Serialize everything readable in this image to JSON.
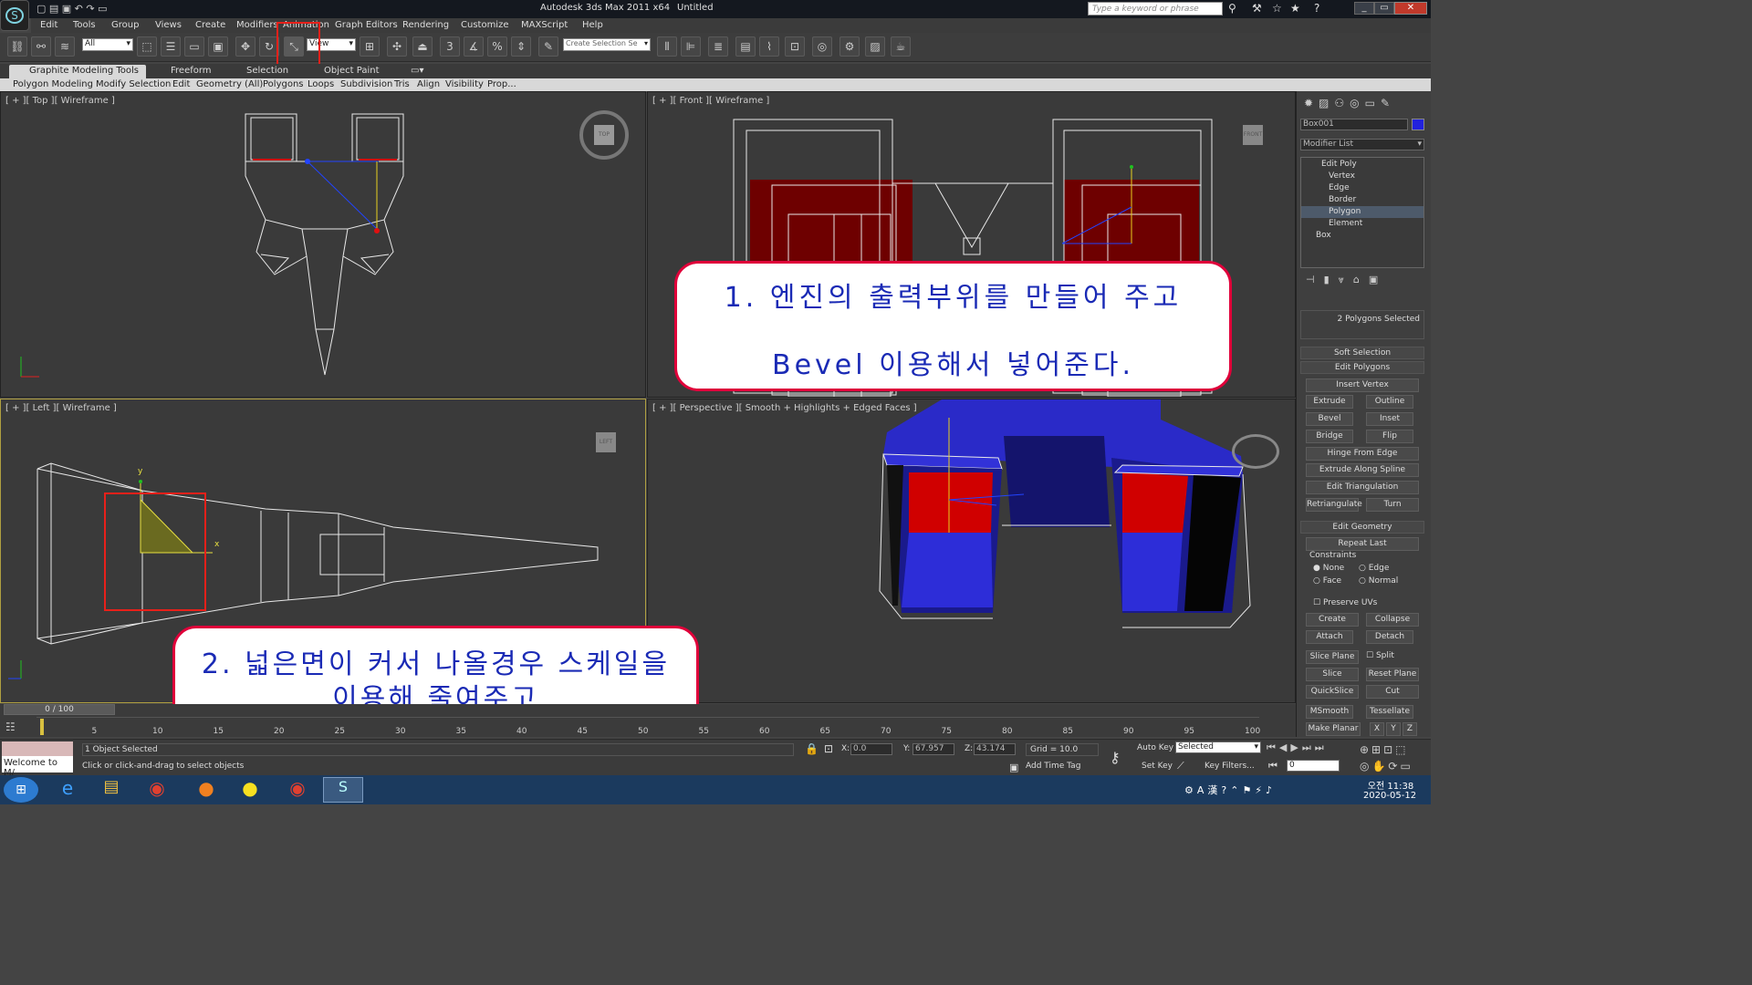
{
  "title": {
    "app": "Autodesk 3ds Max  2011 x64",
    "doc": "Untitled",
    "search_placeholder": "Type a keyword or phrase"
  },
  "menu": [
    "Edit",
    "Tools",
    "Group",
    "Views",
    "Create",
    "Modifiers",
    "Animation",
    "Graph Editors",
    "Rendering",
    "Customize",
    "MAXScript",
    "Help"
  ],
  "toolbar": {
    "selection_filter": "All",
    "ref_coord": "View",
    "named_selection": "Create Selection Se"
  },
  "ribbon": {
    "tabs": [
      "Graphite Modeling Tools",
      "Freeform",
      "Selection",
      "Object Paint"
    ],
    "subtabs": [
      "Polygon Modeling",
      "Modify Selection",
      "Edit",
      "Geometry (All)",
      "Polygons",
      "Loops",
      "Subdivision",
      "Tris",
      "Align",
      "Visibility",
      "Prop..."
    ]
  },
  "viewports": {
    "top": "[ + ][ Top ][ Wireframe ]",
    "front": "[ + ][ Front ][ Wireframe ]",
    "left": "[ + ][ Left ][ Wireframe ]",
    "persp": "[ + ][ Perspective ][ Smooth + Highlights + Edged Faces ]",
    "cube_top": "TOP",
    "cube_front": "FRONT",
    "cube_left": "LEFT"
  },
  "callouts": {
    "c1_line1": "1. 엔진의 출력부위를 만들어 주고",
    "c1_line2": "Bevel 이용해서 넣어준다.",
    "c2_line1": "2. 넓은면이 커서 나올경우 스케일을",
    "c2_line2": "이용해 줄여주고"
  },
  "command_panel": {
    "object_name": "Box001",
    "modifier_list": "Modifier List",
    "stack": [
      "Edit Poly",
      "Vertex",
      "Edge",
      "Border",
      "Polygon",
      "Element",
      "Box"
    ],
    "selected_info": "2 Polygons Selected",
    "soft_selection": "Soft Selection",
    "edit_polygons": "Edit Polygons",
    "insert_vertex": "Insert Vertex",
    "buttons_left": [
      "Extrude",
      "Bevel",
      "Bridge"
    ],
    "buttons_right": [
      "Outline",
      "Inset",
      "Flip"
    ],
    "hinge": "Hinge From Edge",
    "extrude_spline": "Extrude Along Spline",
    "edit_tri": "Edit Triangulation",
    "retri": "Retriangulate",
    "turn": "Turn",
    "edit_geometry": "Edit Geometry",
    "repeat_last": "Repeat Last",
    "constraints": "Constraints",
    "c_none": "None",
    "c_edge": "Edge",
    "c_face": "Face",
    "c_normal": "Normal",
    "preserve_uvs": "Preserve UVs",
    "create": "Create",
    "collapse": "Collapse",
    "attach": "Attach",
    "detach": "Detach",
    "slice_plane": "Slice Plane",
    "split": "Split",
    "slice": "Slice",
    "reset_plane": "Reset Plane",
    "quickslice": "QuickSlice",
    "cut": "Cut",
    "msmooth": "MSmooth",
    "tessellate": "Tessellate",
    "make_planar": "Make Planar",
    "x": "X",
    "y": "Y",
    "z": "Z"
  },
  "timeline": {
    "frame": "0 / 100",
    "ticks": [
      "5",
      "10",
      "15",
      "20",
      "25",
      "30",
      "35",
      "40",
      "45",
      "50",
      "55",
      "60",
      "65",
      "70",
      "75",
      "80",
      "85",
      "90",
      "95",
      "100"
    ]
  },
  "status": {
    "welcome": "Welcome to M/",
    "objects": "1 Object Selected",
    "prompt": "Click or click-and-drag to select objects",
    "x_label": "X:",
    "x": "0.0",
    "y_label": "Y:",
    "y": "67.957",
    "z_label": "Z:",
    "z": "43.174",
    "grid": "Grid = 10.0",
    "auto_key": "Auto Key",
    "set_key": "Set Key",
    "key_mode": "Selected",
    "key_filters": "Key Filters...",
    "add_time_tag": "Add Time Tag",
    "frame_field": "0"
  },
  "taskbar": {
    "time": "오전 11:38",
    "date": "2020-05-12"
  }
}
